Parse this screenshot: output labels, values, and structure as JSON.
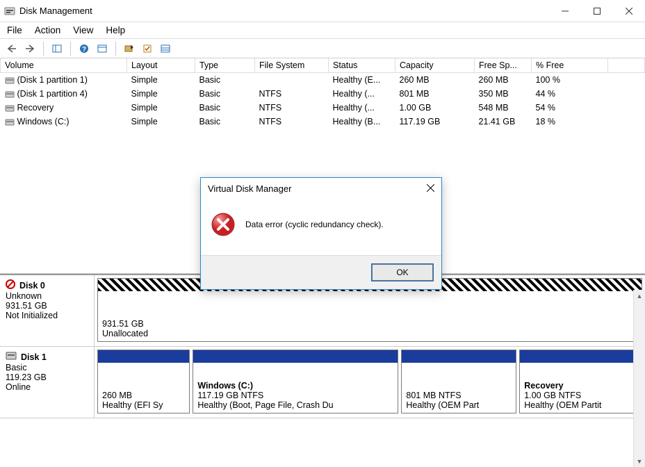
{
  "window": {
    "title": "Disk Management"
  },
  "menu": {
    "items": [
      "File",
      "Action",
      "View",
      "Help"
    ]
  },
  "columns": [
    "Volume",
    "Layout",
    "Type",
    "File System",
    "Status",
    "Capacity",
    "Free Sp...",
    "% Free"
  ],
  "volumes": [
    {
      "name": "(Disk 1 partition 1)",
      "layout": "Simple",
      "type": "Basic",
      "fs": "",
      "status": "Healthy (E...",
      "capacity": "260 MB",
      "free": "260 MB",
      "pct": "100 %"
    },
    {
      "name": "(Disk 1 partition 4)",
      "layout": "Simple",
      "type": "Basic",
      "fs": "NTFS",
      "status": "Healthy (...",
      "capacity": "801 MB",
      "free": "350 MB",
      "pct": "44 %"
    },
    {
      "name": "Recovery",
      "layout": "Simple",
      "type": "Basic",
      "fs": "NTFS",
      "status": "Healthy (...",
      "capacity": "1.00 GB",
      "free": "548 MB",
      "pct": "54 %"
    },
    {
      "name": "Windows (C:)",
      "layout": "Simple",
      "type": "Basic",
      "fs": "NTFS",
      "status": "Healthy (B...",
      "capacity": "117.19 GB",
      "free": "21.41 GB",
      "pct": "18 %"
    }
  ],
  "disks": [
    {
      "title": "Disk 0",
      "status_lines": [
        "Unknown",
        "931.51 GB",
        "Not Initialized"
      ],
      "regions": [
        {
          "label": "",
          "size": "931.51 GB",
          "desc": "Unallocated",
          "flex": 1,
          "top_style": "hatch"
        }
      ]
    },
    {
      "title": "Disk 1",
      "status_lines": [
        "Basic",
        "119.23 GB",
        "Online"
      ],
      "regions": [
        {
          "label": "",
          "size": "260 MB",
          "desc": "Healthy (EFI Sy",
          "flex": 1.1,
          "top_style": "blue"
        },
        {
          "label": "Windows  (C:)",
          "size": "117.19 GB NTFS",
          "desc": "Healthy (Boot, Page File, Crash Du",
          "flex": 2.6,
          "top_style": "blue",
          "bold": true
        },
        {
          "label": "",
          "size": "801 MB NTFS",
          "desc": "Healthy (OEM Part",
          "flex": 1.4,
          "top_style": "blue"
        },
        {
          "label": "Recovery",
          "size": "1.00 GB NTFS",
          "desc": "Healthy (OEM Partit",
          "flex": 1.5,
          "top_style": "blue",
          "bold": true
        }
      ]
    }
  ],
  "dialog": {
    "title": "Virtual Disk Manager",
    "message": "Data error (cyclic redundancy check).",
    "ok": "OK"
  }
}
